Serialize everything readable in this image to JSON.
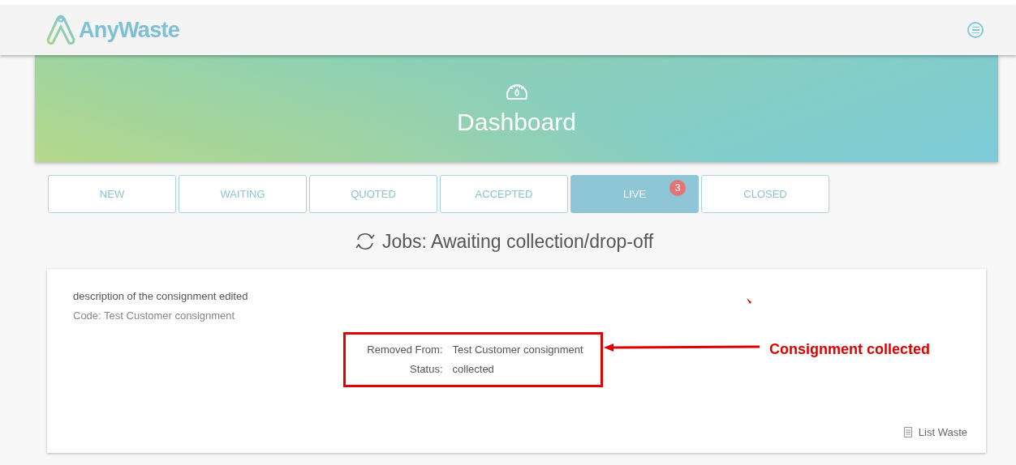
{
  "header": {
    "logo_text": "AnyWaste"
  },
  "banner": {
    "title": "Dashboard"
  },
  "tabs": [
    {
      "label": "NEW",
      "selected": false
    },
    {
      "label": "WAITING",
      "selected": false
    },
    {
      "label": "QUOTED",
      "selected": false
    },
    {
      "label": "ACCEPTED",
      "selected": false
    },
    {
      "label": "LIVE",
      "selected": true,
      "badge": "3"
    },
    {
      "label": "CLOSED",
      "selected": false
    }
  ],
  "section_title": "Jobs: Awaiting collection/drop-off",
  "job": {
    "description": "description of the consignment edited",
    "code": "Code: Test Customer consignment",
    "details": [
      {
        "label": "Removed From:",
        "value": "Test Customer consignment"
      },
      {
        "label": "Status:",
        "value": "collected"
      }
    ],
    "action": "List Waste"
  },
  "annotation": {
    "text": "Consignment collected"
  }
}
